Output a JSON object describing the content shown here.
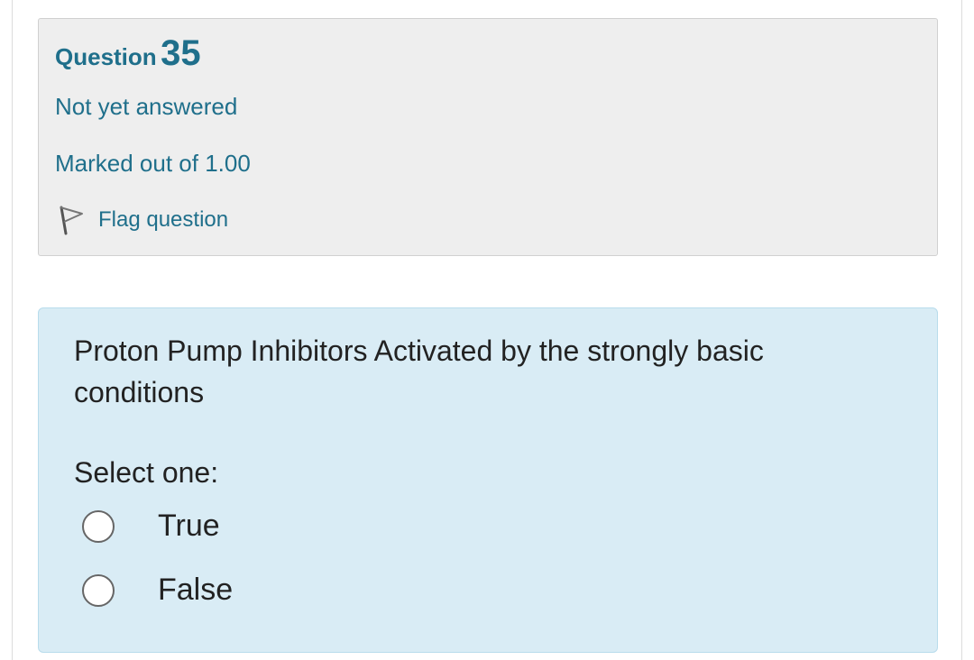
{
  "question_info": {
    "label": "Question",
    "number": "35",
    "state": "Not yet answered",
    "grade": "Marked out of 1.00",
    "flag_label": "Flag question",
    "flag_icon": "flag-icon"
  },
  "question": {
    "text": "Proton Pump Inhibitors Activated by the strongly basic conditions",
    "prompt": "Select one:",
    "options": [
      {
        "label": "True",
        "selected": false
      },
      {
        "label": "False",
        "selected": false
      }
    ]
  },
  "colors": {
    "accent": "#1f6f8b",
    "info_bg": "#eeeeee",
    "question_bg": "#d9ecf5"
  }
}
